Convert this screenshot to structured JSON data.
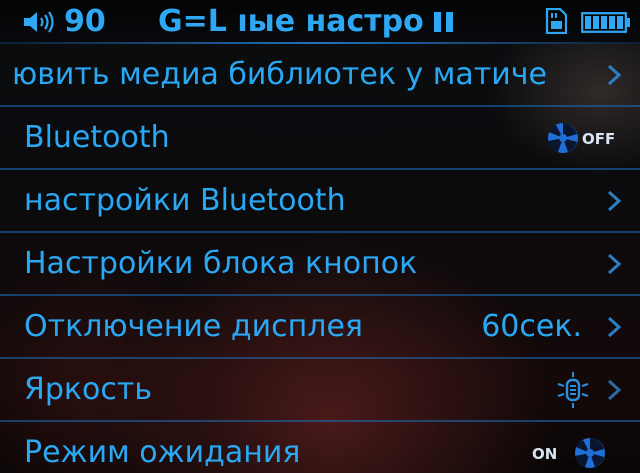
{
  "status": {
    "volume": "90",
    "title": "G=L ıые настро",
    "colors": {
      "accent": "#2aa8f3",
      "background": "#050607"
    }
  },
  "menu": {
    "items": [
      {
        "label": "ювить медиа библиотек у матиче",
        "icon": "chevron-right-icon"
      },
      {
        "label": "Bluetooth",
        "toggle_text": "OFF",
        "icon": "toggle-off-icon"
      },
      {
        "label": "настройки Bluetooth",
        "icon": "chevron-right-icon"
      },
      {
        "label": "Настройки блока кнопок",
        "icon": "chevron-right-icon"
      },
      {
        "label": "Отключение дисплея",
        "value": "60сек.",
        "icon": "chevron-right-icon"
      },
      {
        "label": "Яркость",
        "icon": "brightness-icon"
      },
      {
        "label": "Режим ожидания",
        "toggle_text": "ON",
        "icon": "toggle-on-icon"
      }
    ]
  }
}
